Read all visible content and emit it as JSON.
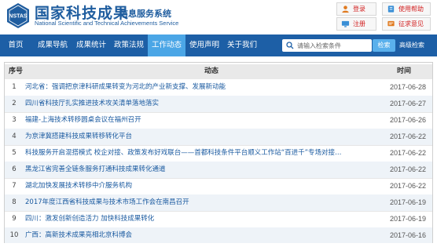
{
  "header": {
    "logo_text": "NSTAS",
    "title": "国家科技成果",
    "subtitle": "信息服务系统",
    "title_en": "National Scientific and Technical Achievements Service",
    "buttons": {
      "login": "登录",
      "help": "使用帮助",
      "register": "注册",
      "jobs": "征求意见"
    }
  },
  "nav": {
    "items": [
      {
        "label": "首页"
      },
      {
        "label": "成果导航"
      },
      {
        "label": "成果统计"
      },
      {
        "label": "政策法规"
      },
      {
        "label": "工作动态",
        "active": true
      },
      {
        "label": "使用声明"
      },
      {
        "label": "关于我们"
      }
    ],
    "search_placeholder": "请输入检索条件",
    "search_button": "检索",
    "advanced_search": "高级检索"
  },
  "table": {
    "columns": {
      "index": "序号",
      "news": "动态",
      "time": "时间"
    },
    "rows": [
      {
        "index": "1",
        "title": "河北省：强调把京津科研成果转变为河北的产业新支撑、发展新动能",
        "date": "2017-06-28"
      },
      {
        "index": "2",
        "title": "四川省科技厅扎实推进技术攻关清单落地落实",
        "date": "2017-06-27"
      },
      {
        "index": "3",
        "title": "福建-上海技术转移圆桌会议在福州召开",
        "date": "2017-06-26"
      },
      {
        "index": "4",
        "title": "为京津冀搭建科技成果转移转化平台",
        "date": "2017-06-22"
      },
      {
        "index": "5",
        "title": "科技服务开启混搭模式 校企对接、政策发布好戏联台——首都科技条件平台顺义工作站“百进千”专场对接暨专...",
        "date": "2017-06-22"
      },
      {
        "index": "6",
        "title": "黑龙江省完善全链条服务打通科技成果转化通道",
        "date": "2017-06-22"
      },
      {
        "index": "7",
        "title": "湖北加快发展技术转移中介服务机构",
        "date": "2017-06-22"
      },
      {
        "index": "8",
        "title": "2017年度江西省科技成果与技术市场工作会在南昌召开",
        "date": "2017-06-19"
      },
      {
        "index": "9",
        "title": "四川：激发创新创造活力 加快科技成果转化",
        "date": "2017-06-19"
      },
      {
        "index": "10",
        "title": "广西：高新技术成果亮相北京科博会",
        "date": "2017-06-16"
      }
    ]
  }
}
